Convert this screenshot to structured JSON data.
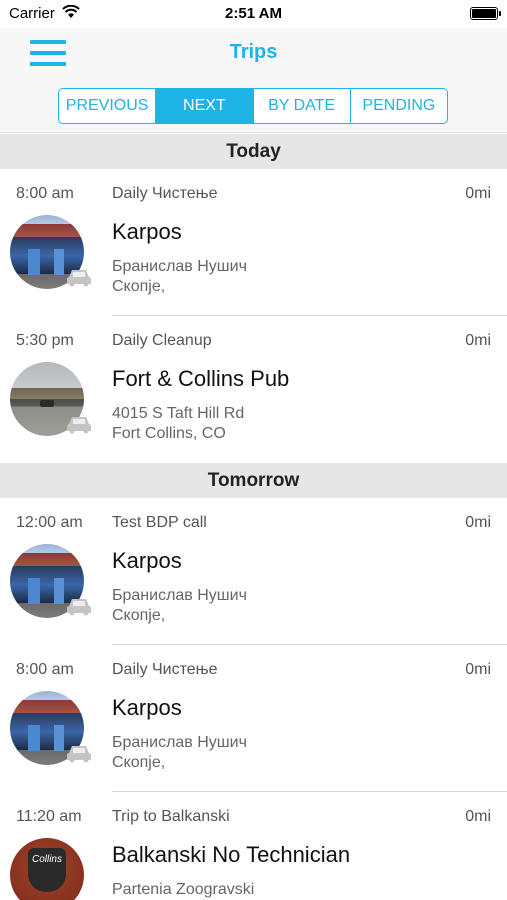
{
  "status_bar": {
    "carrier": "Carrier",
    "time": "2:51 AM"
  },
  "nav": {
    "title": "Trips",
    "menu_icon": "hamburger-menu-icon"
  },
  "segments": [
    {
      "label": "PREVIOUS",
      "active": false
    },
    {
      "label": "NEXT",
      "active": true
    },
    {
      "label": "BY DATE",
      "active": false
    },
    {
      "label": "PENDING",
      "active": false
    }
  ],
  "colors": {
    "accent": "#1eb4e6",
    "section_bg": "#e6e6e6"
  },
  "sections": [
    {
      "header": "Today",
      "trips": [
        {
          "time": "8:00 am",
          "trip": "Daily Чистење",
          "distance": "0mi",
          "name": "Karpos",
          "address_line1": "Бранислав Нушич",
          "address_line2": "Скопје,",
          "avatar": "store"
        },
        {
          "time": "5:30 pm",
          "trip": "Daily Cleanup",
          "distance": "0mi",
          "name": "Fort & Collins Pub",
          "address_line1": "4015 S Taft Hill Rd",
          "address_line2": "Fort Collins, CO",
          "avatar": "pub"
        }
      ]
    },
    {
      "header": "Tomorrow",
      "trips": [
        {
          "time": "12:00 am",
          "trip": "Test BDP call",
          "distance": "0mi",
          "name": "Karpos",
          "address_line1": "Бранислав Нушич",
          "address_line2": "Скопје,",
          "avatar": "store"
        },
        {
          "time": "8:00 am",
          "trip": "Daily Чистење",
          "distance": "0mi",
          "name": "Karpos",
          "address_line1": "Бранислав Нушич",
          "address_line2": "Скопје,",
          "avatar": "store"
        },
        {
          "time": "11:20 am",
          "trip": "Trip to Balkanski",
          "distance": "0mi",
          "name": "Balkanski No Technician",
          "address_line1": "Partenia Zoogravski",
          "address_line2": "",
          "avatar": "logo",
          "logo_text": "Collins"
        }
      ]
    }
  ]
}
